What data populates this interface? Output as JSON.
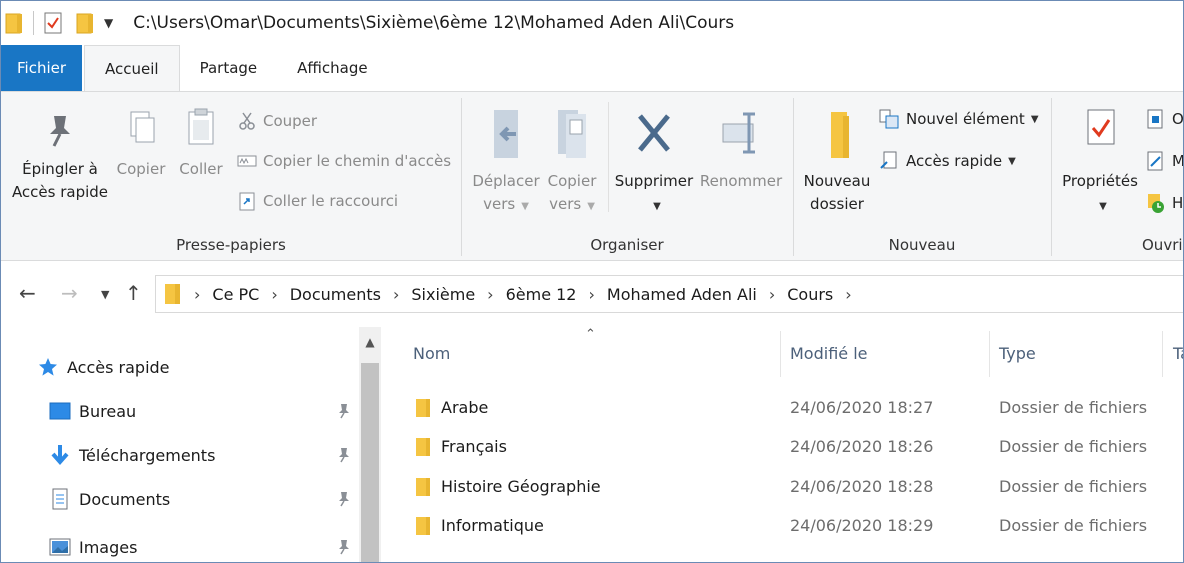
{
  "window": {
    "title_path": "C:\\Users\\Omar\\Documents\\Sixième\\6ème 12\\Mohamed Aden Ali\\Cours"
  },
  "tabs": [
    {
      "label": "Fichier"
    },
    {
      "label": "Accueil"
    },
    {
      "label": "Partage"
    },
    {
      "label": "Affichage"
    }
  ],
  "ribbon": {
    "presse_papiers": {
      "label": "Presse-papiers",
      "pin_line1": "Épingler à",
      "pin_line2": "Accès rapide",
      "copy": "Copier",
      "paste": "Coller",
      "cut": "Couper",
      "copy_path": "Copier le chemin d'accès",
      "paste_shortcut": "Coller le raccourci"
    },
    "organiser": {
      "label": "Organiser",
      "move_line1": "Déplacer",
      "move_line2": "vers",
      "copyto_line1": "Copier",
      "copyto_line2": "vers",
      "delete": "Supprimer",
      "rename": "Renommer"
    },
    "nouveau": {
      "label": "Nouveau",
      "newfolder_line1": "Nouveau",
      "newfolder_line2": "dossier",
      "new_item": "Nouvel élément",
      "quick_access": "Accès rapide"
    },
    "ouvrir": {
      "label": "Ouvrir",
      "properties": "Propriétés",
      "open_short": "O",
      "modify_short": "M",
      "history_short": "H"
    }
  },
  "address": {
    "crumbs": [
      "Ce PC",
      "Documents",
      "Sixième",
      "6ème 12",
      "Mohamed Aden Ali",
      "Cours"
    ]
  },
  "navpane": {
    "quick_access": "Accès rapide",
    "items": [
      {
        "label": "Bureau"
      },
      {
        "label": "Téléchargements"
      },
      {
        "label": "Documents"
      },
      {
        "label": "Images"
      }
    ]
  },
  "filelist": {
    "columns": {
      "name": "Nom",
      "modified": "Modifié le",
      "type": "Type",
      "size_short": "Ta"
    },
    "rows": [
      {
        "name": "Arabe",
        "modified": "24/06/2020 18:27",
        "type": "Dossier de fichiers"
      },
      {
        "name": "Français",
        "modified": "24/06/2020 18:26",
        "type": "Dossier de fichiers"
      },
      {
        "name": "Histoire Géographie",
        "modified": "24/06/2020 18:28",
        "type": "Dossier de fichiers"
      },
      {
        "name": "Informatique",
        "modified": "24/06/2020 18:29",
        "type": "Dossier de fichiers"
      }
    ]
  },
  "colors": {
    "accent": "#1976c5",
    "folder": "#f5c542",
    "header_text": "#4c607a"
  }
}
